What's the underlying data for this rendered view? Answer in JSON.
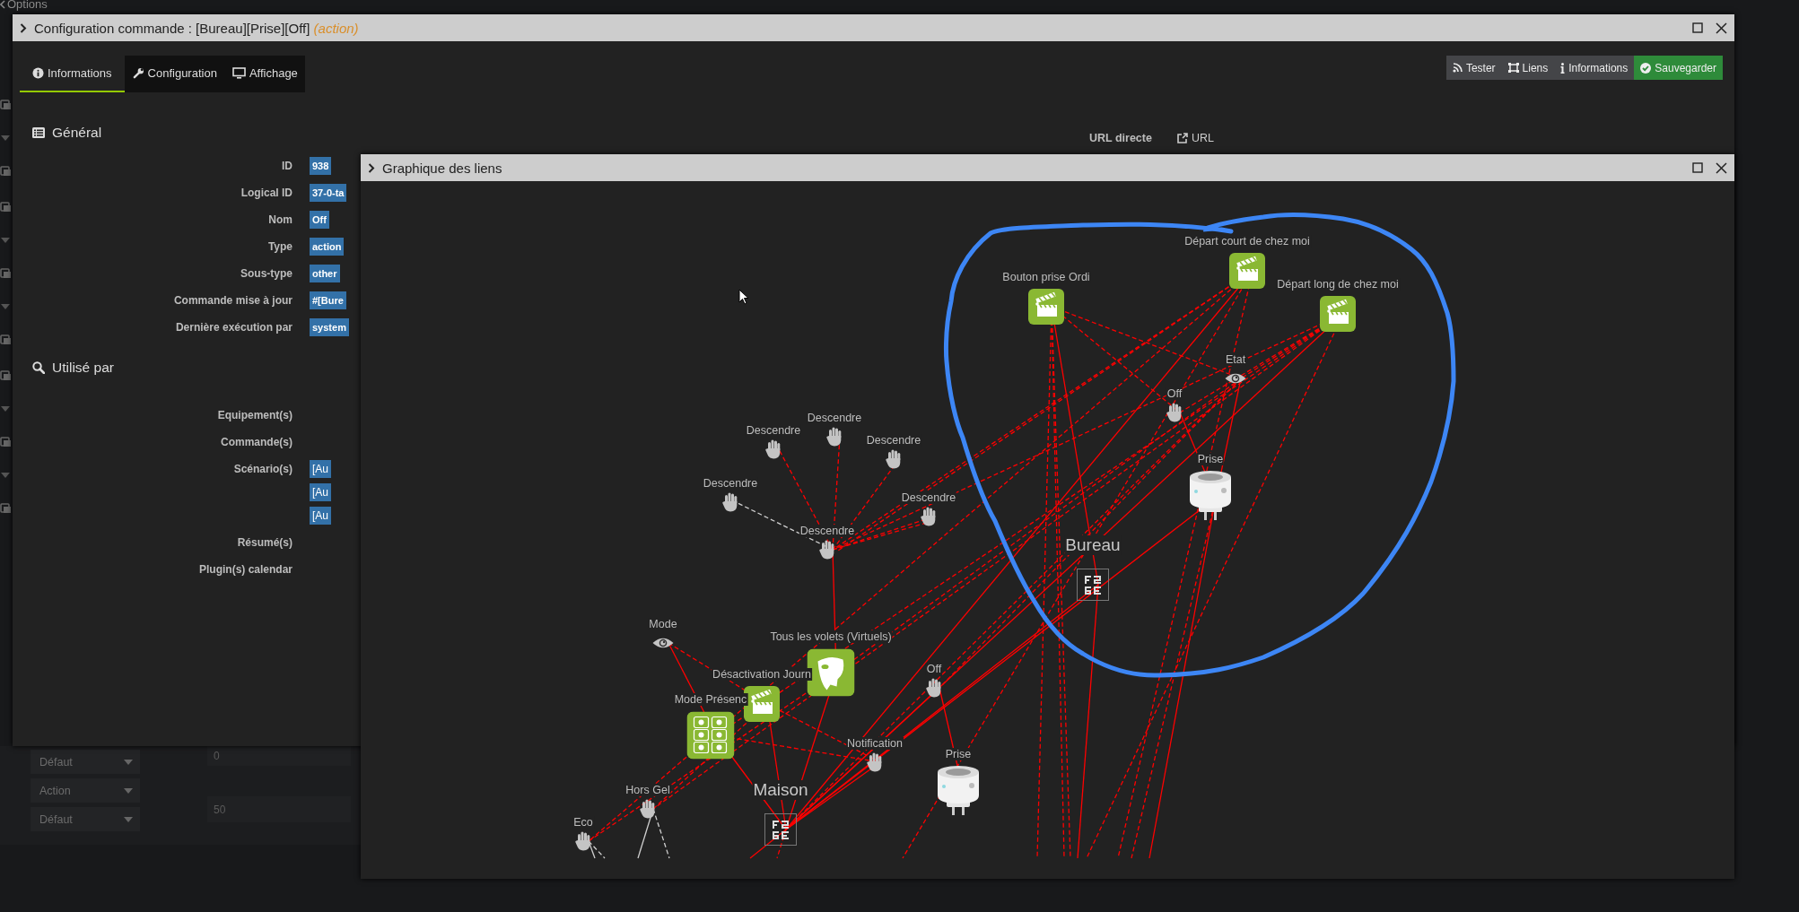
{
  "background": {
    "menu_label": "Options",
    "selects": [
      "Défaut",
      "Action",
      "Défaut"
    ],
    "inputs": [
      "0",
      "50"
    ]
  },
  "config_window": {
    "title": "Configuration commande : [Bureau][Prise][Off]",
    "title_note": "(action)",
    "tabs": [
      {
        "label": "Informations",
        "selected": true
      },
      {
        "label": "Configuration",
        "selected": false
      },
      {
        "label": "Affichage",
        "selected": false
      }
    ],
    "buttons": [
      {
        "label": "Tester",
        "kind": "default"
      },
      {
        "label": "Liens",
        "kind": "default"
      },
      {
        "label": "Informations",
        "kind": "default"
      },
      {
        "label": "Sauvegarder",
        "kind": "primary"
      }
    ],
    "general": {
      "heading": "Général",
      "fields": [
        {
          "label": "ID",
          "value": "938"
        },
        {
          "label": "Logical ID",
          "value": "37-0-ta"
        },
        {
          "label": "Nom",
          "value": "Off"
        },
        {
          "label": "Type",
          "value": "action"
        },
        {
          "label": "Sous-type",
          "value": "other"
        },
        {
          "label": "Commande mise à jour",
          "value": "#[Bure"
        },
        {
          "label": "Dernière exécution par",
          "value": "system"
        }
      ]
    },
    "url": {
      "label": "URL directe",
      "link": "URL"
    },
    "used_by": {
      "heading": "Utilisé par",
      "fields": [
        {
          "label": "Equipement(s)"
        },
        {
          "label": "Commande(s)"
        },
        {
          "label": "Scénario(s)",
          "values": [
            "[Au",
            "[Au",
            "[Au"
          ]
        },
        {
          "label": "Résumé(s)"
        },
        {
          "label": "Plugin(s) calendar"
        }
      ]
    }
  },
  "links_window": {
    "title": "Graphique des liens",
    "nodes": [
      {
        "label": "Bouton prise Ordi",
        "kind": "scenario"
      },
      {
        "label": "Départ court de chez moi",
        "kind": "scenario"
      },
      {
        "label": "Départ long de chez moi",
        "kind": "scenario"
      },
      {
        "label": "Etat",
        "kind": "info"
      },
      {
        "label": "Off",
        "kind": "action"
      },
      {
        "label": "Prise",
        "kind": "plug"
      },
      {
        "label": "Bureau",
        "kind": "object"
      },
      {
        "label": "Descendre",
        "kind": "action"
      },
      {
        "label": "Descendre",
        "kind": "action"
      },
      {
        "label": "Descendre",
        "kind": "action"
      },
      {
        "label": "Descendre",
        "kind": "action"
      },
      {
        "label": "Descendre",
        "kind": "action"
      },
      {
        "label": "Descendre",
        "kind": "action"
      },
      {
        "label": "Mode",
        "kind": "info"
      },
      {
        "label": "Tous les volets (Virtuels)",
        "kind": "virtual"
      },
      {
        "label": "Désactivation Journ",
        "kind": "scenario"
      },
      {
        "label": "Mode Présenc",
        "kind": "mode"
      },
      {
        "label": "Notification",
        "kind": "action"
      },
      {
        "label": "Off",
        "kind": "action"
      },
      {
        "label": "Prise",
        "kind": "plug"
      },
      {
        "label": "Maison",
        "kind": "object"
      },
      {
        "label": "Hors Gel",
        "kind": "action"
      },
      {
        "label": "Eco",
        "kind": "action"
      }
    ]
  }
}
